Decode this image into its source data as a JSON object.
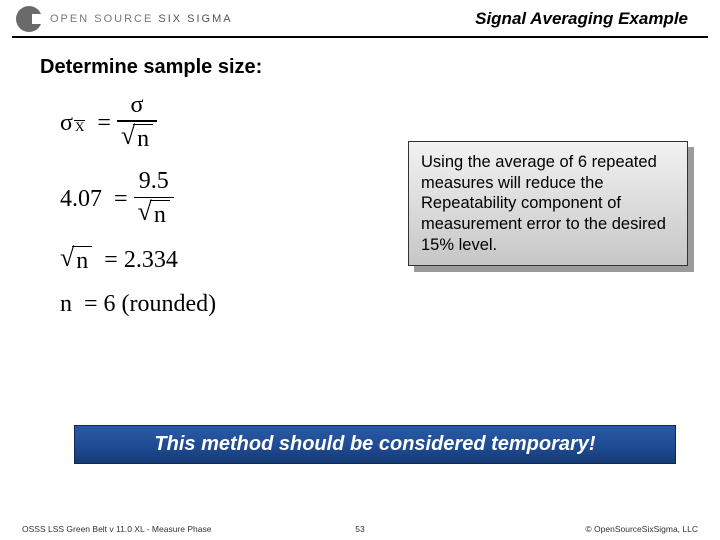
{
  "brand": {
    "part1": "OPEN SOURCE",
    "part2": "SIX SIGMA"
  },
  "title": "Signal Averaging Example",
  "heading": "Determine sample size:",
  "eq": {
    "sigma": "σ",
    "x": "X",
    "n": "n",
    "eq1_lhs_val": "4.07",
    "eq1_rhs_num": "9.5",
    "eq2_rhs": "2.334",
    "eq3_lhs": "n",
    "eq3_rhs": "6 (rounded)",
    "equals": "="
  },
  "callout": "Using the average of 6 repeated measures will reduce the Repeatability component of measurement error to the desired 15% level.",
  "banner": "This method should be considered temporary!",
  "footer": {
    "left": "OSSS LSS Green Belt v 11.0 XL - Measure Phase",
    "page": "53",
    "copy": "© OpenSourceSixSigma, LLC"
  }
}
